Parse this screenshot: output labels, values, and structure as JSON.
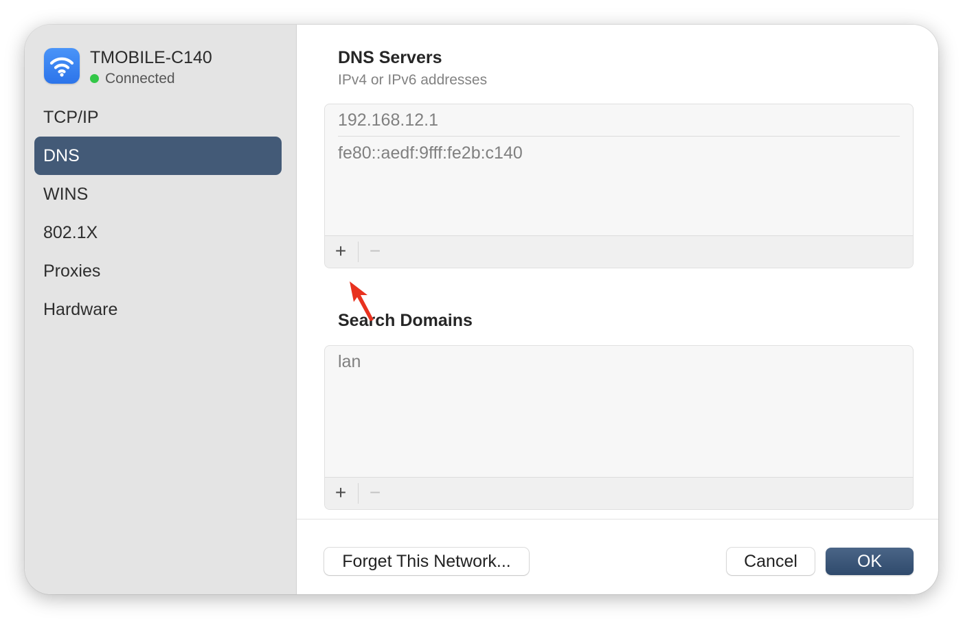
{
  "network": {
    "name": "TMOBILE-C140",
    "status": "Connected",
    "icon": "wifi-icon",
    "status_color": "#33c748"
  },
  "sidebar": {
    "items": [
      {
        "label": "TCP/IP",
        "selected": false
      },
      {
        "label": "DNS",
        "selected": true
      },
      {
        "label": "WINS",
        "selected": false
      },
      {
        "label": "802.1X",
        "selected": false
      },
      {
        "label": "Proxies",
        "selected": false
      },
      {
        "label": "Hardware",
        "selected": false
      }
    ],
    "selected_color": "#435a77"
  },
  "dns": {
    "title": "DNS Servers",
    "subtitle": "IPv4 or IPv6 addresses",
    "servers": [
      "192.168.12.1",
      "fe80::aedf:9fff:fe2b:c140"
    ],
    "add_label": "+",
    "remove_label": "−"
  },
  "search_domains": {
    "title": "Search Domains",
    "domains": [
      "lan"
    ],
    "add_label": "+",
    "remove_label": "−"
  },
  "footer": {
    "forget_label": "Forget This Network...",
    "cancel_label": "Cancel",
    "ok_label": "OK",
    "ok_color": "#2f4a6c"
  },
  "annotation": {
    "icon": "red-arrow-icon",
    "color": "#e8321f"
  }
}
